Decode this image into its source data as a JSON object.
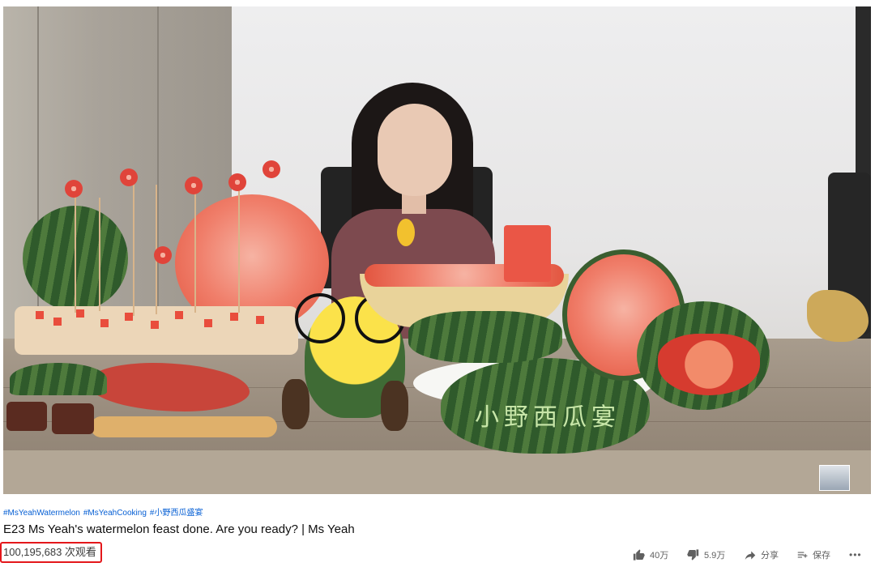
{
  "video": {
    "carving_text": "小野西瓜宴"
  },
  "hashtags": [
    "#MsYeahWatermelon",
    "#MsYeahCooking",
    "#小野西瓜盛宴"
  ],
  "title": "E23 Ms Yeah's watermelon feast done. Are you ready? | Ms Yeah",
  "views": "100,195,683 次观看",
  "actions": {
    "like_count": "40万",
    "dislike_count": "5.9万",
    "share_label": "分享",
    "save_label": "保存",
    "more_label": "•••"
  },
  "colors": {
    "hashtag": "#065fd4",
    "highlight_box": "#e4171b",
    "meta_text": "#606060"
  },
  "icons": [
    "like-icon",
    "dislike-icon",
    "share-icon",
    "save-playlist-icon",
    "more-icon"
  ]
}
